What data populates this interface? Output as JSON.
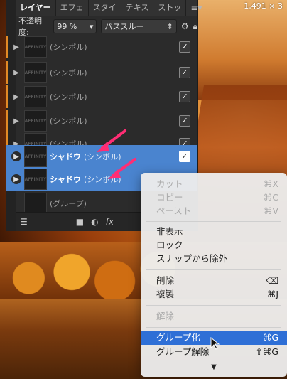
{
  "resolution_label": "1,491 × 3",
  "tabs": [
    {
      "label": "レイヤー",
      "active": true
    },
    {
      "label": "エフェ"
    },
    {
      "label": "スタイ"
    },
    {
      "label": "テキス"
    },
    {
      "label": "ストッ"
    }
  ],
  "tabs_menu_icon": "hamburger-icon",
  "controls": {
    "opacity_label": "不透明度:",
    "opacity_value": "99 %",
    "blend_value": "パススルー"
  },
  "layers": [
    {
      "name": "",
      "type": "(シンボル)",
      "checked": true,
      "thumb_text": "AFFINITY",
      "selected": false,
      "expandable": true
    },
    {
      "name": "",
      "type": "(シンボル)",
      "checked": true,
      "thumb_text": "AFFINITY",
      "selected": false,
      "expandable": true
    },
    {
      "name": "",
      "type": "(シンボル)",
      "checked": true,
      "thumb_text": "AFFINITY",
      "selected": false,
      "expandable": true
    },
    {
      "name": "",
      "type": "(シンボル)",
      "checked": true,
      "thumb_text": "AFFINITY",
      "selected": false,
      "expandable": true
    },
    {
      "name": "",
      "type": "(シンボル)",
      "checked": true,
      "thumb_text": "AFFINITY",
      "selected": false,
      "expandable": true
    },
    {
      "name": "シャドウ",
      "type": "(シンボル)",
      "checked": true,
      "thumb_text": "AFFINITY",
      "selected": true,
      "expandable": true
    },
    {
      "name": "シャドウ",
      "type": "(シンボル)",
      "checked": true,
      "thumb_text": "AFFINITY",
      "selected": true,
      "expandable": true
    },
    {
      "name": "",
      "type": "(グループ)",
      "checked": false,
      "thumb_text": "",
      "selected": false,
      "expandable": false
    }
  ],
  "context_menu": {
    "items": [
      {
        "label": "カット",
        "shortcut": "⌘X",
        "disabled": true
      },
      {
        "label": "コピー",
        "shortcut": "⌘C",
        "disabled": true
      },
      {
        "label": "ペースト",
        "shortcut": "⌘V",
        "disabled": true
      },
      {
        "label": "非表示",
        "shortcut": "",
        "disabled": false
      },
      {
        "label": "ロック",
        "shortcut": "",
        "disabled": false
      },
      {
        "label": "スナップから除外",
        "shortcut": "",
        "disabled": false
      },
      {
        "label": "削除",
        "shortcut": "⌫",
        "disabled": false
      },
      {
        "label": "複製",
        "shortcut": "⌘J",
        "disabled": false
      },
      {
        "label": "解除",
        "shortcut": "",
        "disabled": true
      },
      {
        "label": "グループ化",
        "shortcut": "⌘G",
        "disabled": false,
        "highlighted": true
      },
      {
        "label": "グループ解除",
        "shortcut": "⇧⌘G",
        "disabled": false
      }
    ],
    "more_glyph": "▼"
  },
  "accent_color": "#e28a26",
  "selection_color": "#4a84cf",
  "highlight_color": "#2e6fd6"
}
